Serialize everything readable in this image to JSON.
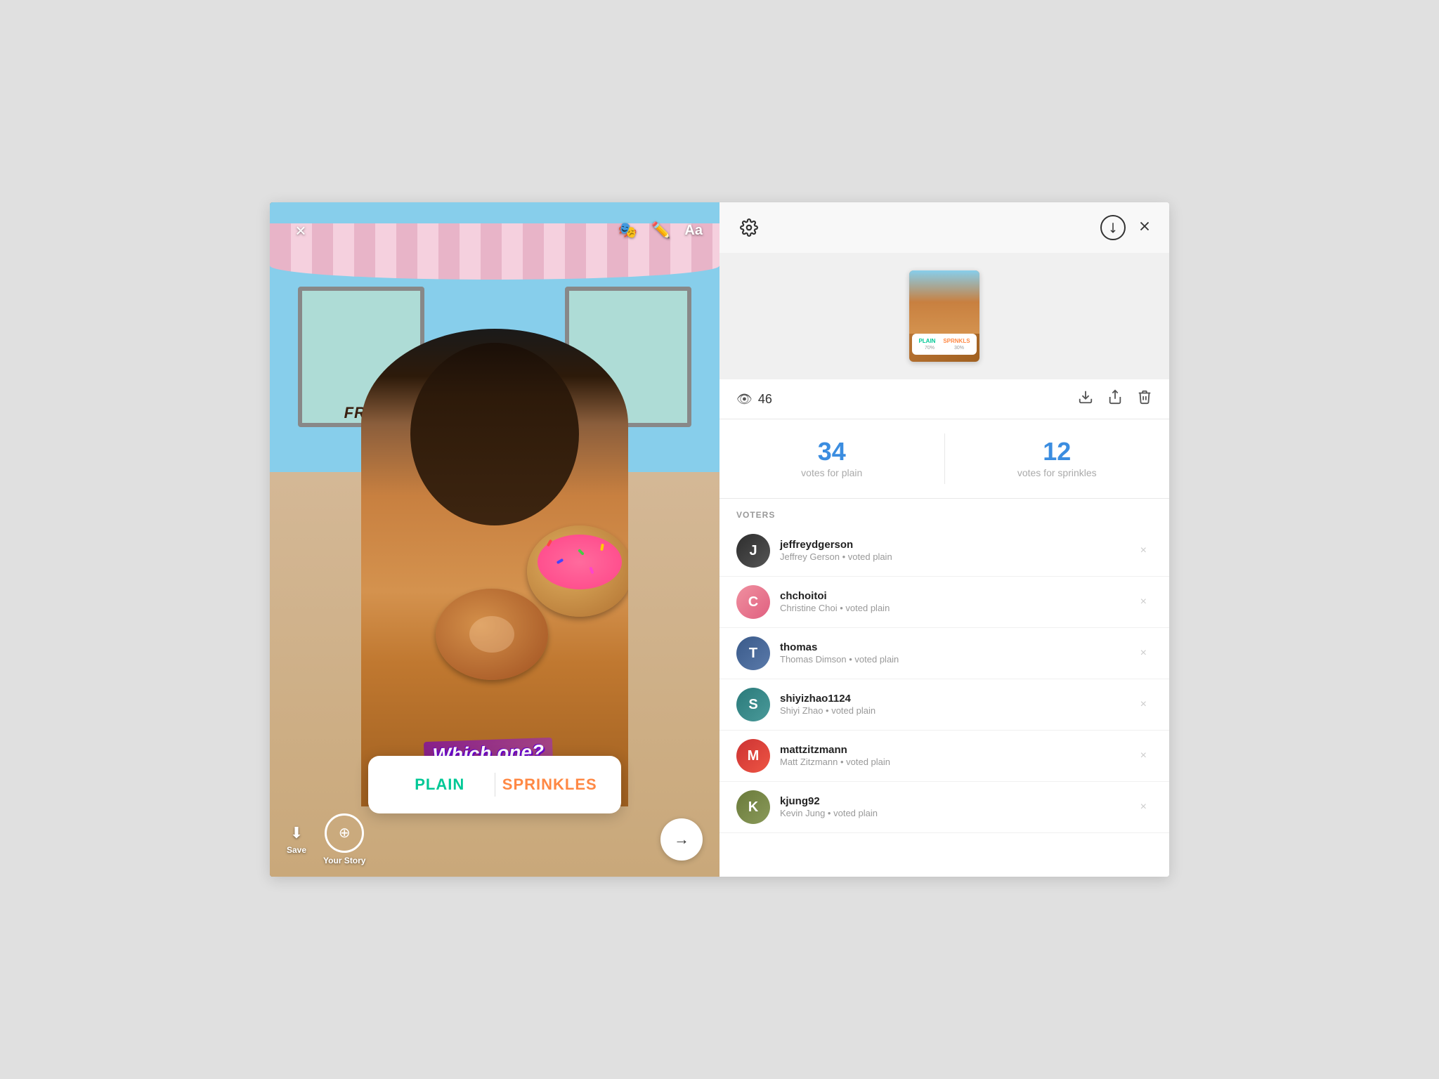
{
  "left": {
    "close_label": "×",
    "tools": [
      "🎭",
      "✏️",
      "Aa"
    ],
    "poll_question": "Which one?",
    "poll_option_plain": "PLAIN",
    "poll_option_sprinkles": "SPRINKLES",
    "bottom_actions": [
      {
        "icon": "⬇",
        "label": "Save"
      },
      {
        "icon": "⊕",
        "label": "Your Story"
      }
    ],
    "next_arrow": "→"
  },
  "right": {
    "views_count": "46",
    "votes_plain_number": "34",
    "votes_plain_label": "votes for plain",
    "votes_sprinkles_number": "12",
    "votes_sprinkles_label": "votes for sprinkles",
    "voters_header": "VOTERS",
    "voters": [
      {
        "username": "jeffreydgerson",
        "detail": "Jeffrey Gerson • voted plain",
        "avatar_letter": "J",
        "avatar_class": "av-dark"
      },
      {
        "username": "chchoitoi",
        "detail": "Christine Choi • voted plain",
        "avatar_letter": "C",
        "avatar_class": "av-pink"
      },
      {
        "username": "thomas",
        "detail": "Thomas Dimson • voted plain",
        "avatar_letter": "T",
        "avatar_class": "av-blue-dark"
      },
      {
        "username": "shiyizhao1124",
        "detail": "Shiyi Zhao • voted plain",
        "avatar_letter": "S",
        "avatar_class": "av-teal"
      },
      {
        "username": "mattzitzmann",
        "detail": "Matt Zitzmann • voted plain",
        "avatar_letter": "M",
        "avatar_class": "av-red"
      },
      {
        "username": "kjung92",
        "detail": "Kevin Jung • voted plain",
        "avatar_letter": "K",
        "avatar_class": "av-olive"
      }
    ]
  }
}
